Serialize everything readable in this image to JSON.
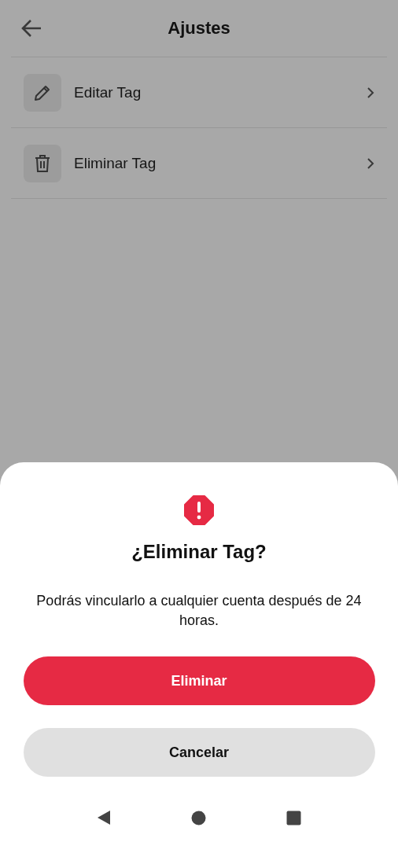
{
  "header": {
    "title": "Ajustes"
  },
  "settings": [
    {
      "kind": "edit",
      "label": "Editar Tag"
    },
    {
      "kind": "delete",
      "label": "Eliminar Tag"
    }
  ],
  "dialog": {
    "title": "¿Eliminar Tag?",
    "message": "Podrás vincularlo a cualquier cuenta después de 24 horas.",
    "buttons": [
      {
        "kind": "primary",
        "label": "Eliminar"
      },
      {
        "kind": "secondary",
        "label": "Cancelar"
      }
    ]
  }
}
